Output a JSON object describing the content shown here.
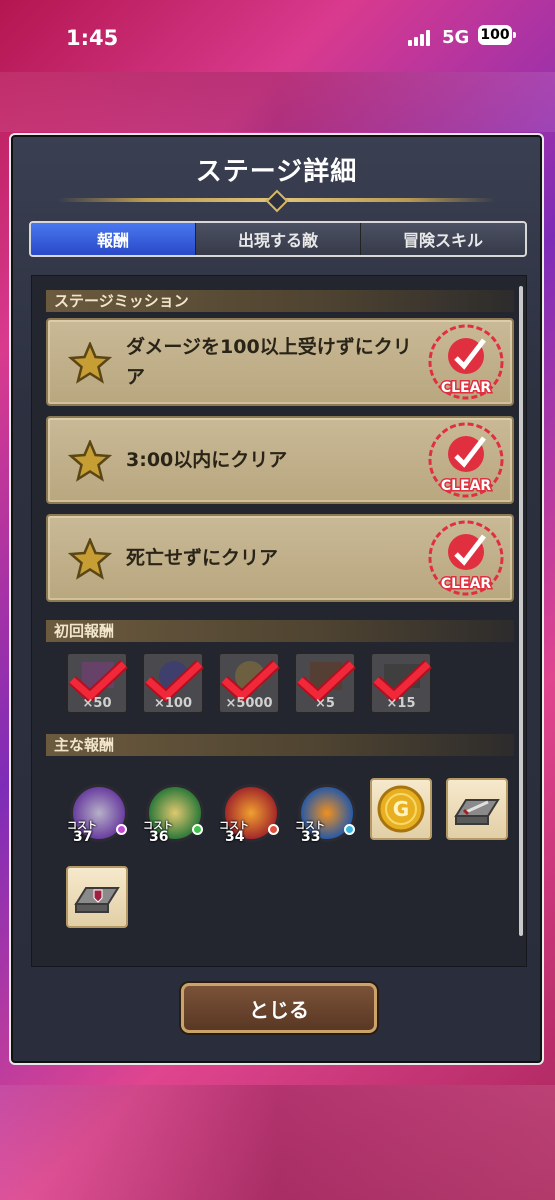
{
  "status_bar": {
    "time": "1:45",
    "network": "5G",
    "battery": "100"
  },
  "dialog": {
    "title": "ステージ詳細",
    "tabs": [
      {
        "label": "報酬",
        "active": true
      },
      {
        "label": "出現する敵",
        "active": false
      },
      {
        "label": "冒険スキル",
        "active": false
      }
    ],
    "sections": {
      "missions_header": "ステージミッション",
      "first_reward_header": "初回報酬",
      "main_reward_header": "主な報酬"
    },
    "missions": [
      {
        "text": "ダメージを100以上受けずにクリア",
        "stamp": "CLEAR"
      },
      {
        "text": "3:00以内にクリア",
        "stamp": "CLEAR"
      },
      {
        "text": "死亡せずにクリア",
        "stamp": "CLEAR"
      }
    ],
    "first_rewards": [
      {
        "qty": "×50",
        "icon": "purple-gem-icon",
        "claimed": true
      },
      {
        "qty": "×100",
        "icon": "orb-icon",
        "claimed": true
      },
      {
        "qty": "×5000",
        "icon": "gold-coin-icon",
        "claimed": true
      },
      {
        "qty": "×5",
        "icon": "book-icon",
        "claimed": true
      },
      {
        "qty": "×15",
        "icon": "ticket-icon",
        "claimed": true
      }
    ],
    "main_rewards": {
      "cost_label": "コスト",
      "monsters": [
        {
          "cost": "37",
          "icon": "golem-monster-icon",
          "ring": "#6a3fa0",
          "dot": "#c24bd6"
        },
        {
          "cost": "36",
          "icon": "elf-monster-icon",
          "ring": "#2f7a3a",
          "dot": "#3fc24b"
        },
        {
          "cost": "34",
          "icon": "flame-monster-icon",
          "ring": "#a42a2a",
          "dot": "#e0503c"
        },
        {
          "cost": "33",
          "icon": "slime-monster-icon",
          "ring": "#2a5aa4",
          "dot": "#3cb6e0"
        }
      ],
      "items": [
        {
          "icon": "gold-g-coin-icon"
        },
        {
          "icon": "sword-ingot-icon"
        },
        {
          "icon": "shield-ingot-icon"
        }
      ]
    },
    "close_button": "とじる"
  }
}
